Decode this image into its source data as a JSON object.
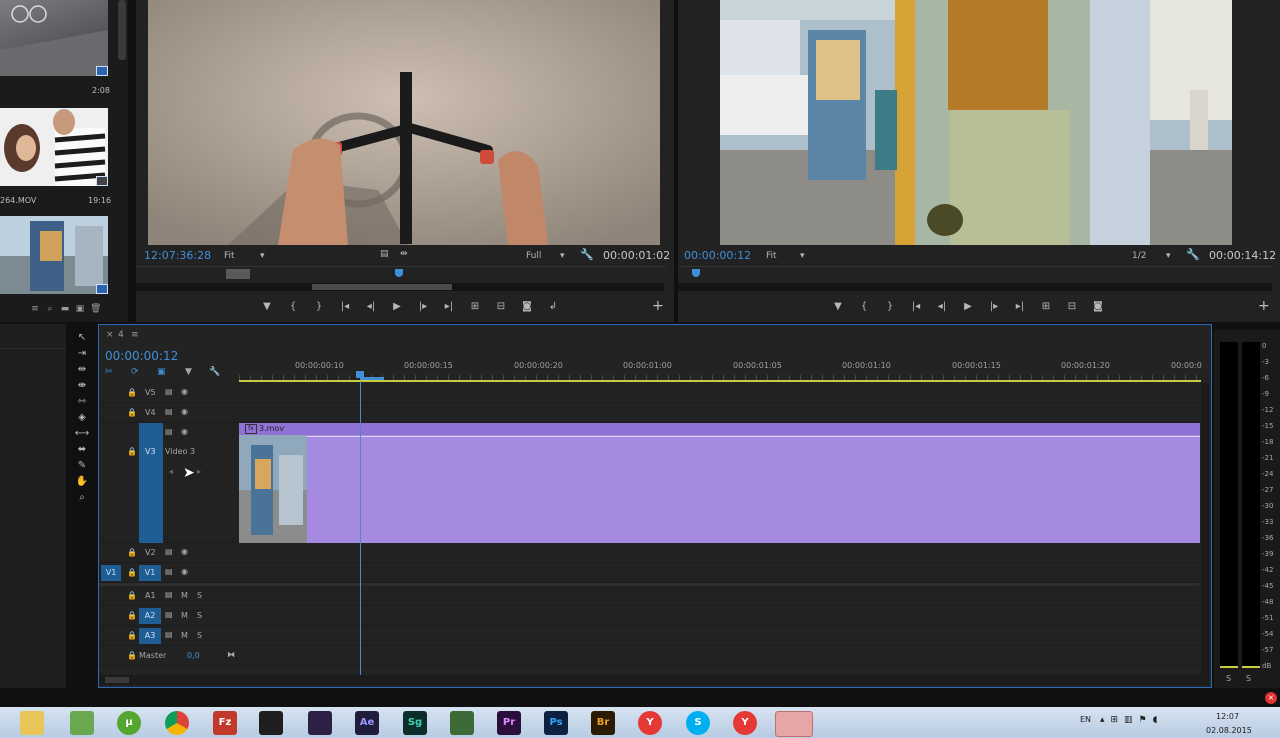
{
  "project": {
    "clips": [
      {
        "duration": "2:08",
        "name": ""
      },
      {
        "duration": "19:16",
        "name": "264.MOV"
      },
      {
        "duration": "",
        "name": ""
      }
    ]
  },
  "source_monitor": {
    "timecode_left": "12:07:36:28",
    "fit_label": "Fit",
    "quality_label": "Full",
    "timecode_right": "00:00:01:02"
  },
  "program_monitor": {
    "timecode_left": "00:00:00:12",
    "fit_label": "Fit",
    "quality_label": "1/2",
    "timecode_right": "00:00:14:12"
  },
  "timeline": {
    "tab_label": "4",
    "current_time": "00:00:00:12",
    "ruler_labels": [
      "00:00:00:10",
      "00:00:00:15",
      "00:00:00:20",
      "00:00:01:00",
      "00:00:01:05",
      "00:00:01:10",
      "00:00:01:15",
      "00:00:01:20",
      "00:00:0"
    ],
    "clip_name": "3.mov",
    "tracks": {
      "v5": "V5",
      "v4": "V4",
      "v3": "V3",
      "v3_name": "Video 3",
      "v2": "V2",
      "v1": "V1",
      "v1_src": "V1",
      "a1": "A1",
      "a2": "A2",
      "a3": "A3",
      "mute": "M",
      "solo": "S",
      "master": "Master",
      "master_value": "0,0"
    },
    "clip_color": "#a58ae0"
  },
  "audio_meter": {
    "db_labels": [
      "0",
      "-3",
      "-6",
      "-9",
      "-12",
      "-15",
      "-18",
      "-21",
      "-24",
      "-27",
      "-30",
      "-33",
      "-36",
      "-39",
      "-42",
      "-45",
      "-48",
      "-51",
      "-54",
      "-57",
      "dB"
    ],
    "solo_left": "S",
    "solo_right": "S"
  },
  "taskbar": {
    "language": "EN",
    "time": "12:07",
    "date": "02.08.2015",
    "apps": [
      "Ae",
      "Sg",
      "Pr",
      "Ps",
      "Br"
    ]
  }
}
